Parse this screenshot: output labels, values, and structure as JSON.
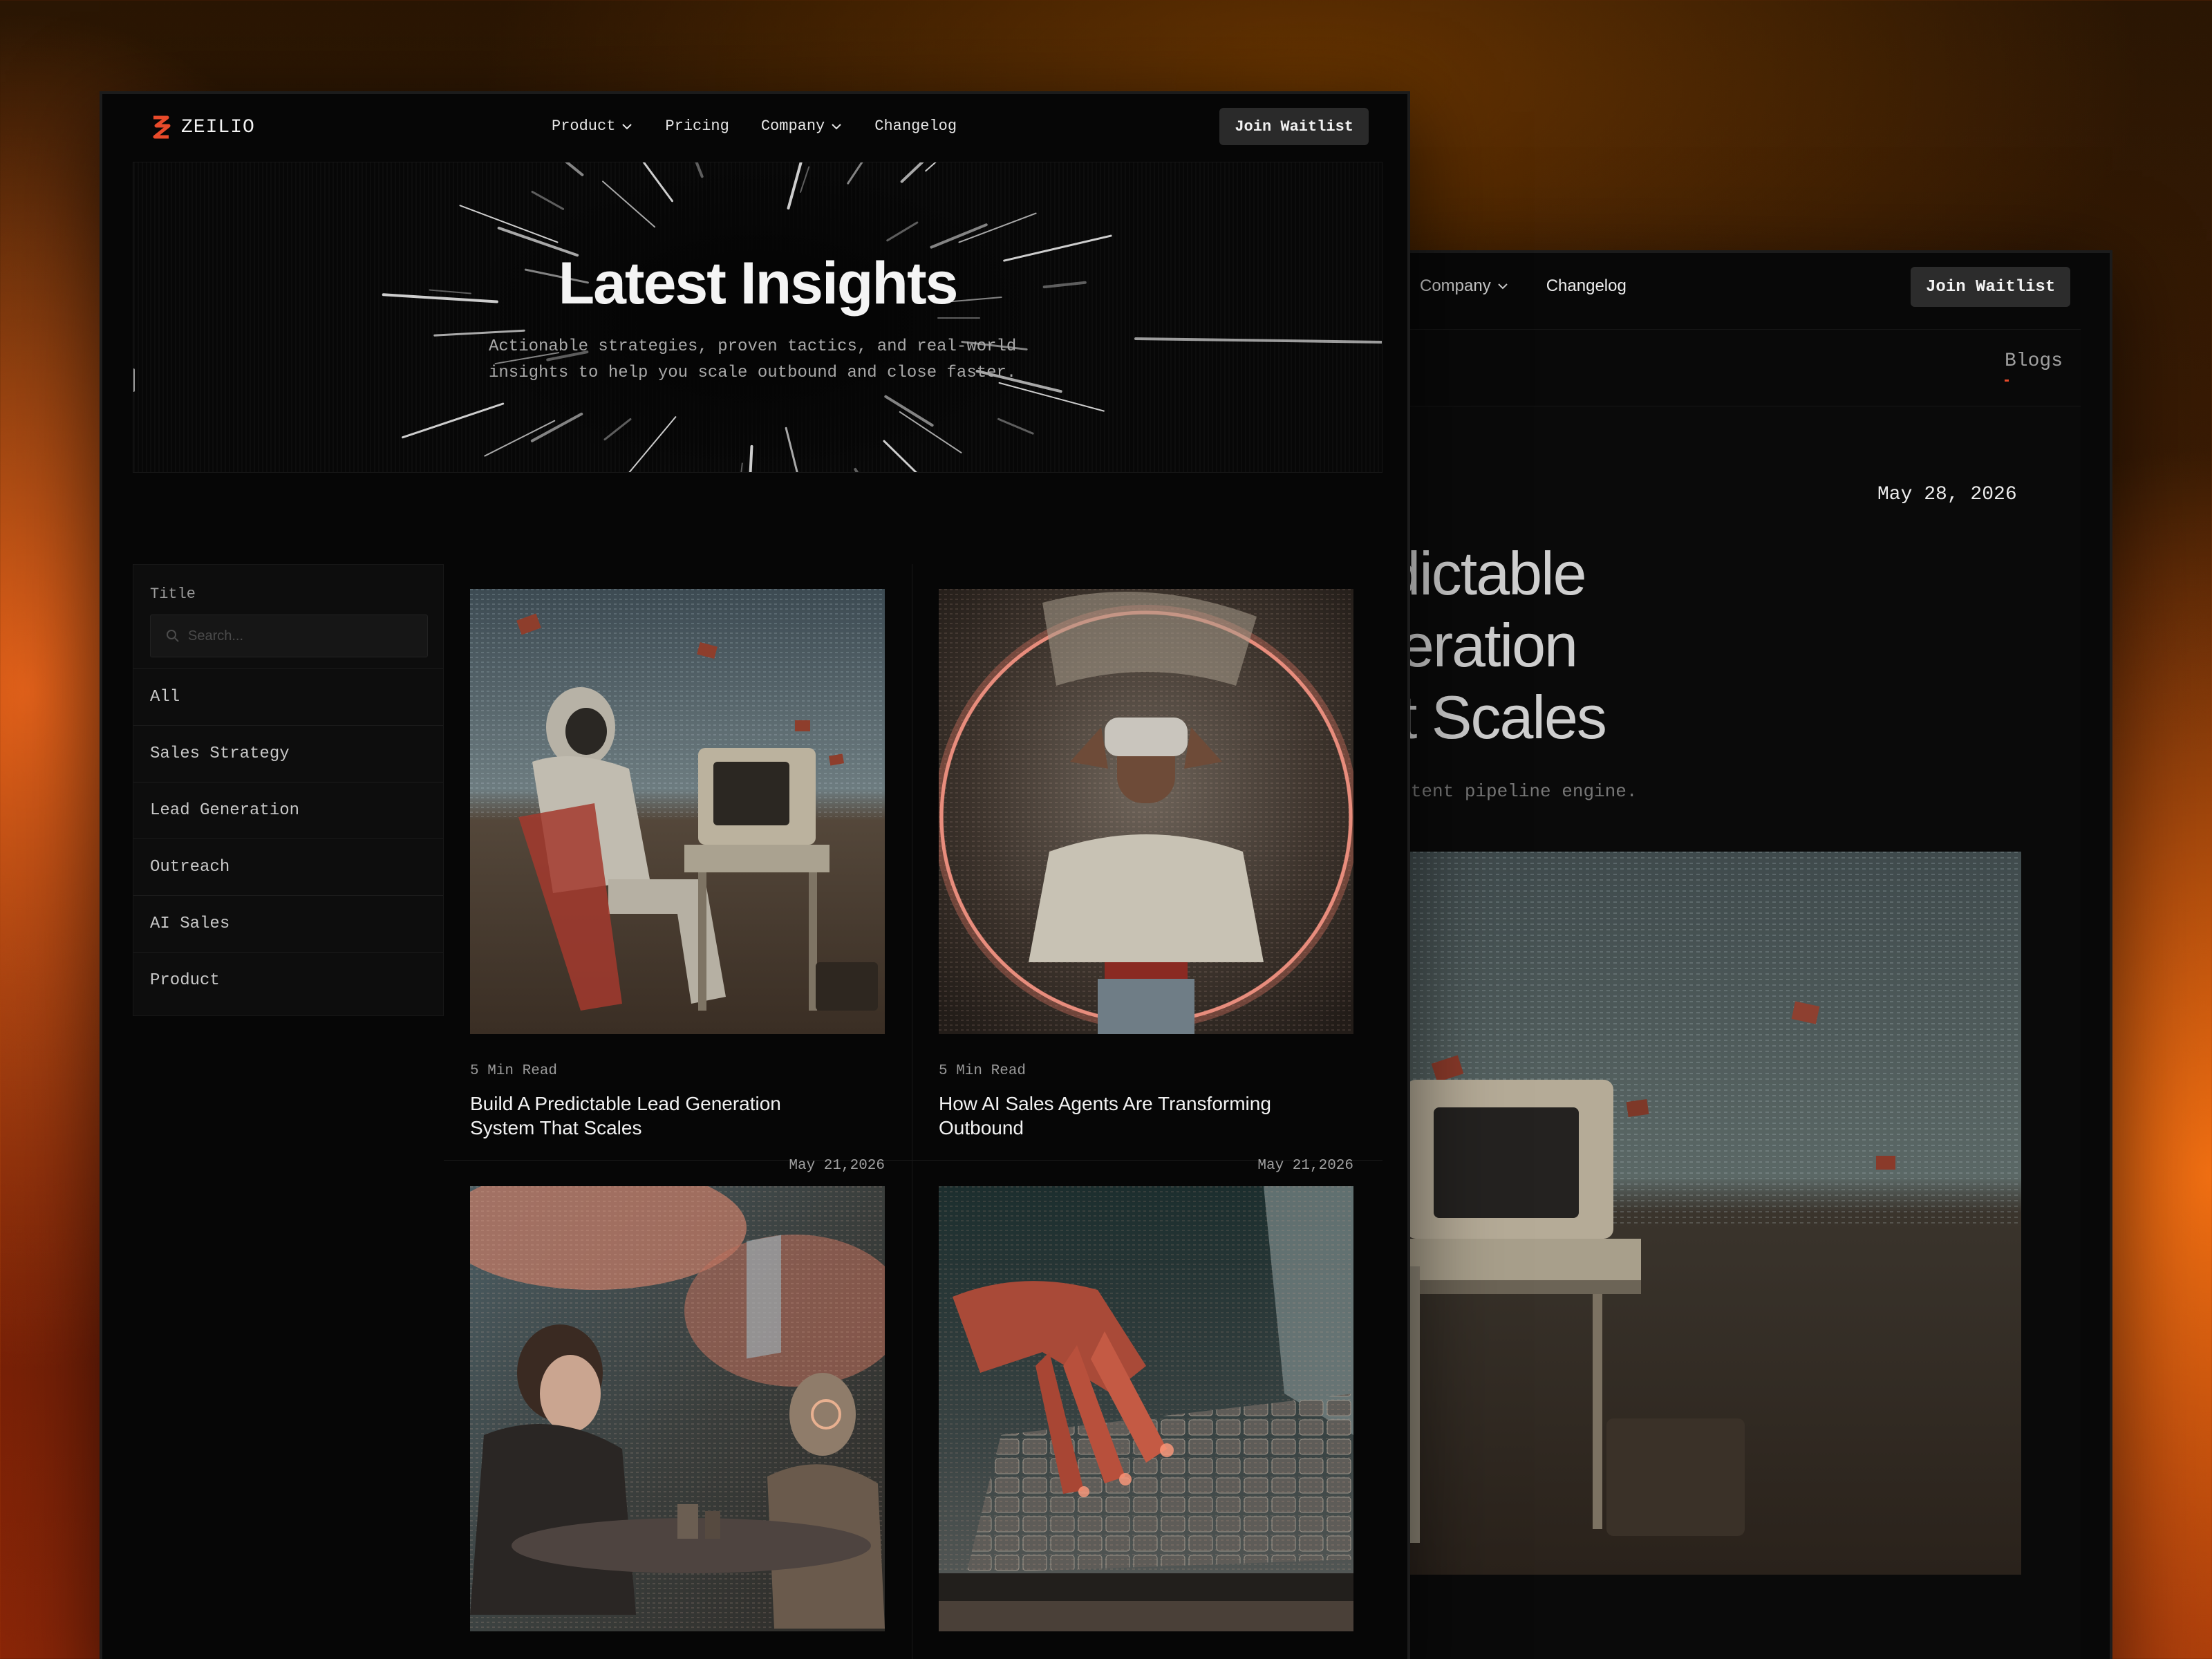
{
  "brand": {
    "name": "ZEILIO",
    "accent": "#e84a2a"
  },
  "nav": {
    "links": [
      {
        "label": "Product",
        "has_dropdown": true
      },
      {
        "label": "Pricing",
        "has_dropdown": false
      },
      {
        "label": "Company",
        "has_dropdown": true
      },
      {
        "label": "Changelog",
        "has_dropdown": false
      }
    ],
    "cta": "Join Waitlist"
  },
  "hero": {
    "title": "Latest Insights",
    "subtitle": "Actionable strategies, proven tactics, and real-world insights to help you scale outbound and close faster."
  },
  "filters": {
    "label": "Title",
    "search_placeholder": "Search...",
    "categories": [
      "All",
      "Sales Strategy",
      "Lead Generation",
      "Outreach",
      "AI Sales",
      "Product"
    ]
  },
  "posts": [
    {
      "read_time": "5 Min Read",
      "title": "Build A Predictable Lead Generation System That Scales",
      "date": "May 21,2026",
      "image": "astronaut-at-retro-computer-in-desert"
    },
    {
      "read_time": "5 Min Read",
      "title": "How AI Sales Agents Are Transforming Outbound",
      "date": "May 21,2026",
      "image": "woman-with-vr-headset-in-glowing-ring"
    },
    {
      "image": "man-and-robot-at-cafe-table"
    },
    {
      "image": "robot-hand-on-laptop-keyboard"
    }
  ],
  "article_window": {
    "nav_links": [
      {
        "label": "Company",
        "has_dropdown": true
      },
      {
        "label": "Changelog",
        "has_dropdown": false
      }
    ],
    "cta": "Join Waitlist",
    "breadcrumb": "Blogs",
    "date": "May 28, 2026",
    "title_lines": [
      "redictable",
      "eneration",
      "hat Scales"
    ],
    "description": "sistent pipeline engine.",
    "image": "astronaut-at-retro-computer-in-desert"
  }
}
